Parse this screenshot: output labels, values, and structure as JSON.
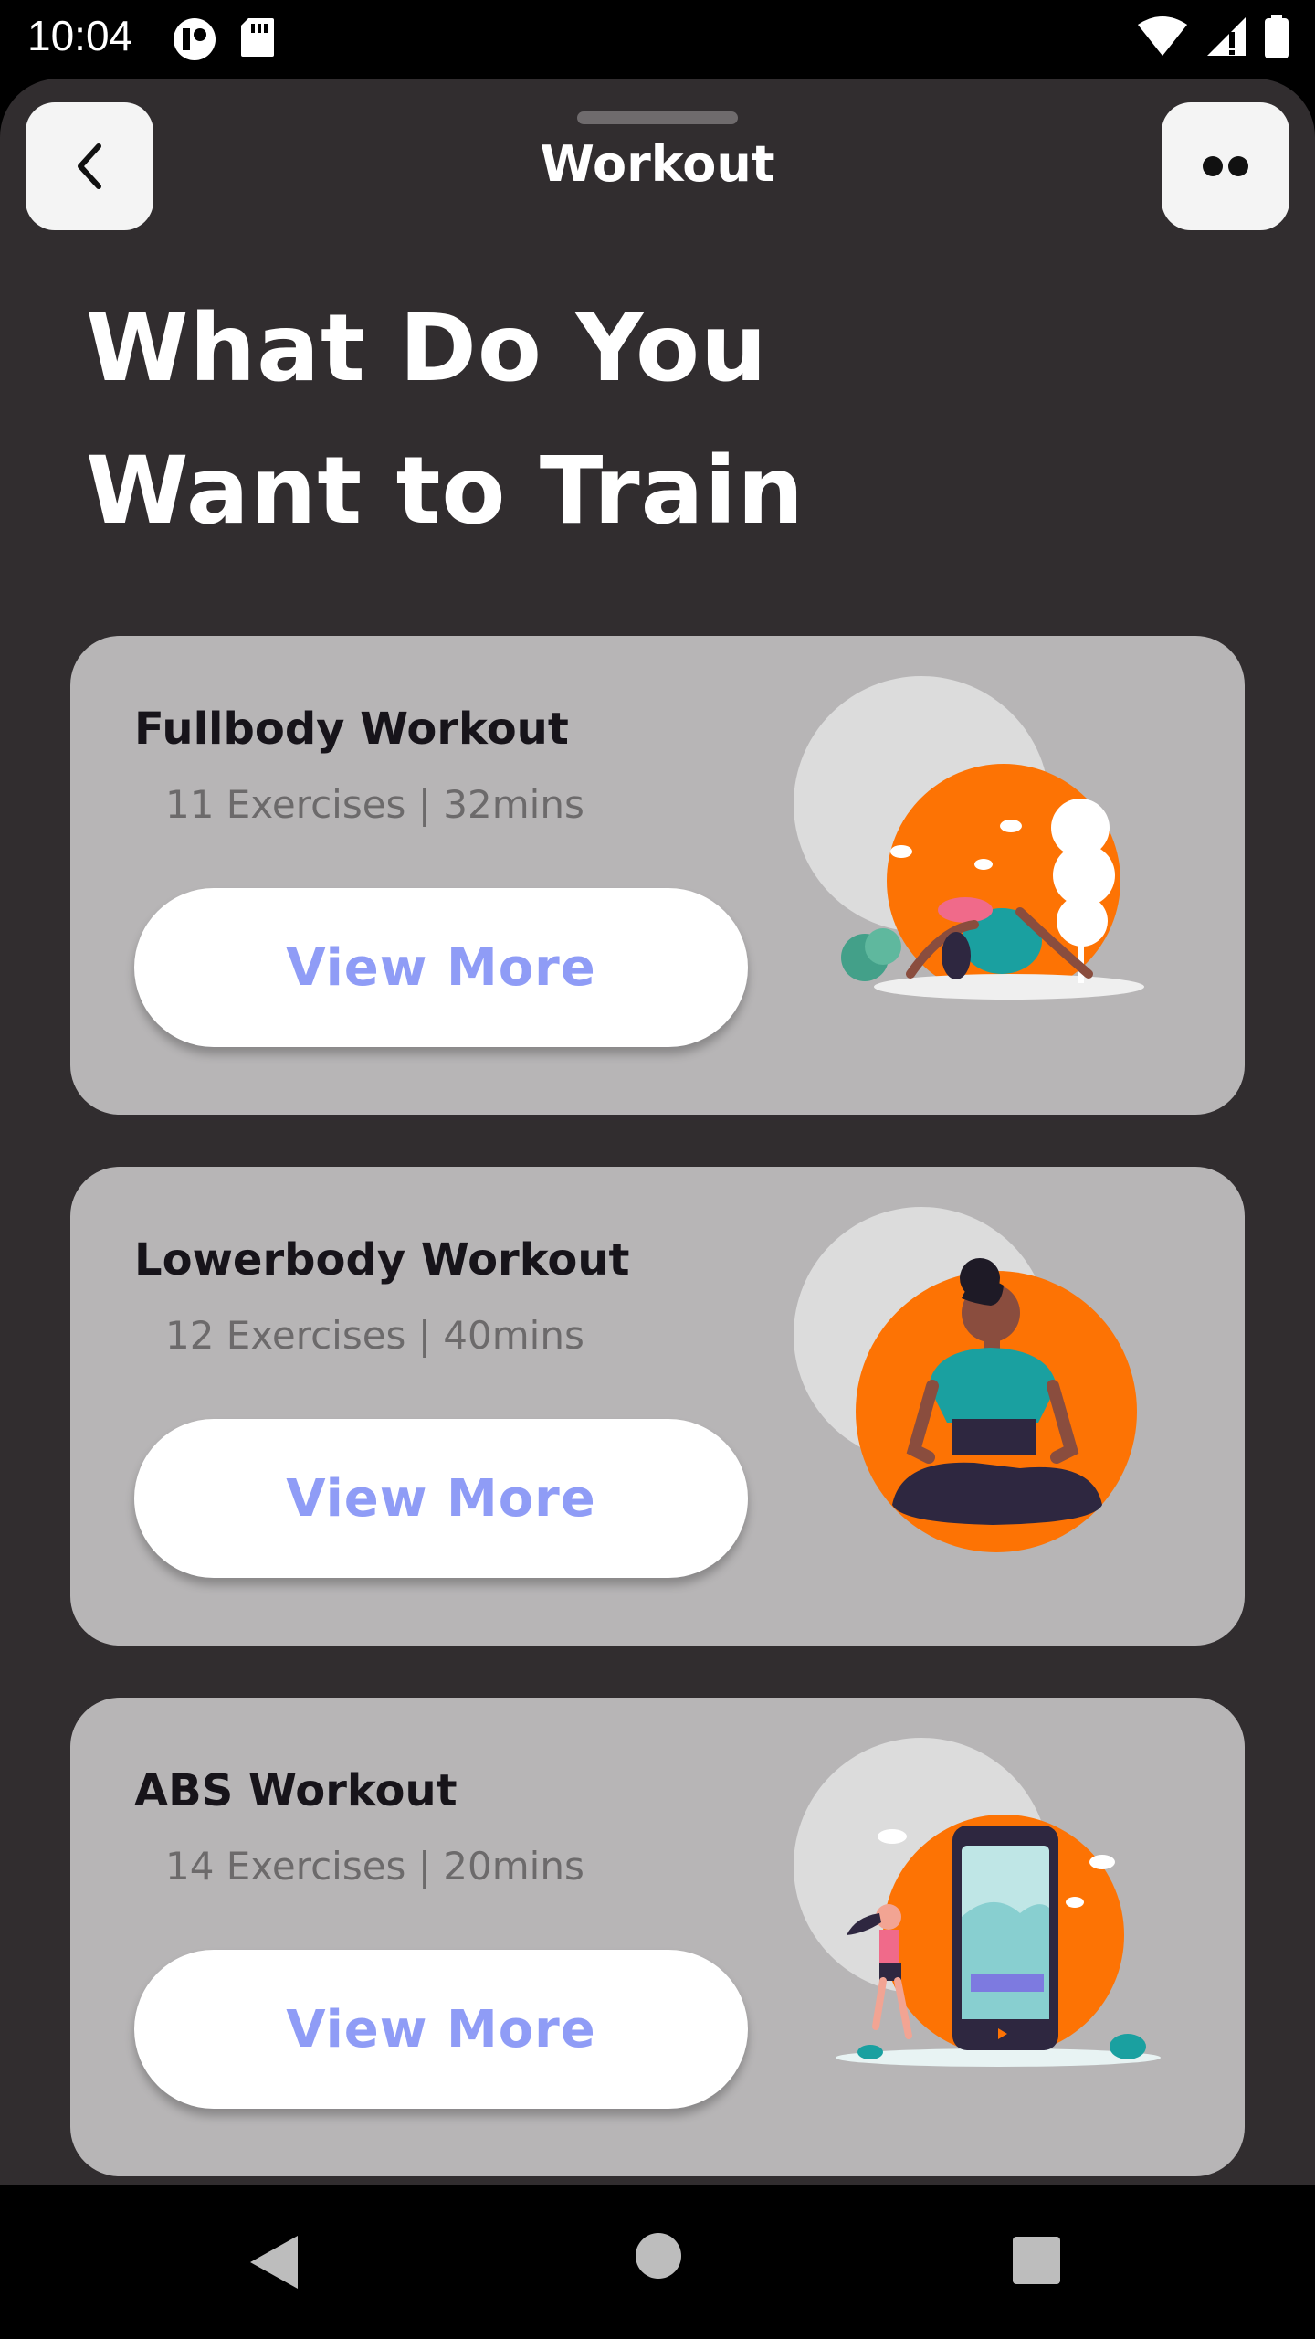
{
  "status_bar": {
    "time": "10:04",
    "icons": [
      "app-notification-icon",
      "sd-card-icon",
      "wifi-icon",
      "signal-icon",
      "battery-icon"
    ]
  },
  "header": {
    "title": "Workout",
    "back_icon": "chevron-left-icon",
    "more_icon": "two-dots-icon"
  },
  "page": {
    "heading_line1": "What Do You",
    "heading_line2": "Want to Train"
  },
  "cards": [
    {
      "title": "Fullbody Workout",
      "meta": "11 Exercises | 32mins",
      "button_label": "View More",
      "illustration": "stretching-woman-illustration"
    },
    {
      "title": "Lowerbody Workout",
      "meta": "12 Exercises | 40mins",
      "button_label": "View More",
      "illustration": "meditating-woman-illustration"
    },
    {
      "title": "ABS Workout",
      "meta": "14 Exercises | 20mins",
      "button_label": "View More",
      "illustration": "phone-runner-illustration"
    }
  ],
  "nav_bar": {
    "icons": [
      "nav-back-icon",
      "nav-home-icon",
      "nav-recents-icon"
    ]
  },
  "colors": {
    "background": "#312d2f",
    "card": "#b7b5b6",
    "accent_orange": "#fd7304",
    "button_text": "#8f9cf6",
    "teal": "#1aa0a0"
  }
}
